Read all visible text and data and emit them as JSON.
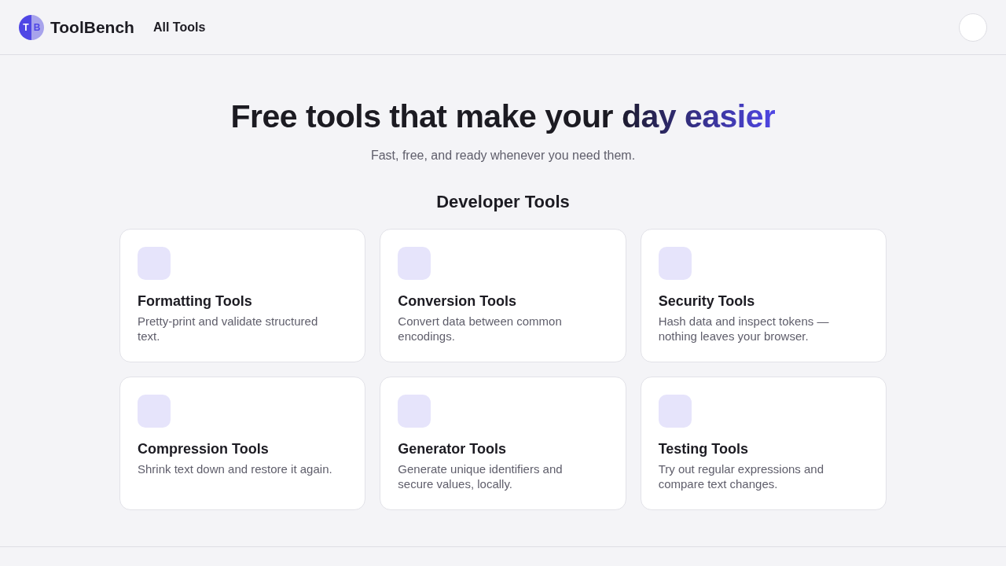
{
  "header": {
    "logo": {
      "left": "T",
      "right": "B"
    },
    "brand": "ToolBench",
    "nav_link": "All Tools"
  },
  "hero": {
    "headline": "Free tools that make your",
    "highlight": "day easier",
    "subtitle": "Fast, free, and ready whenever you need them."
  },
  "section": {
    "title": "Developer Tools",
    "cards": [
      {
        "title": "Formatting Tools",
        "description": "Pretty-print and validate structured text."
      },
      {
        "title": "Conversion Tools",
        "description": "Convert data between common encodings."
      },
      {
        "title": "Security Tools",
        "description": "Hash data and inspect tokens — nothing leaves your browser."
      },
      {
        "title": "Compression Tools",
        "description": "Shrink text down and restore it again."
      },
      {
        "title": "Generator Tools",
        "description": "Generate unique identifiers and secure values, locally."
      },
      {
        "title": "Testing Tools",
        "description": "Try out regular expressions and compare text changes."
      }
    ]
  }
}
